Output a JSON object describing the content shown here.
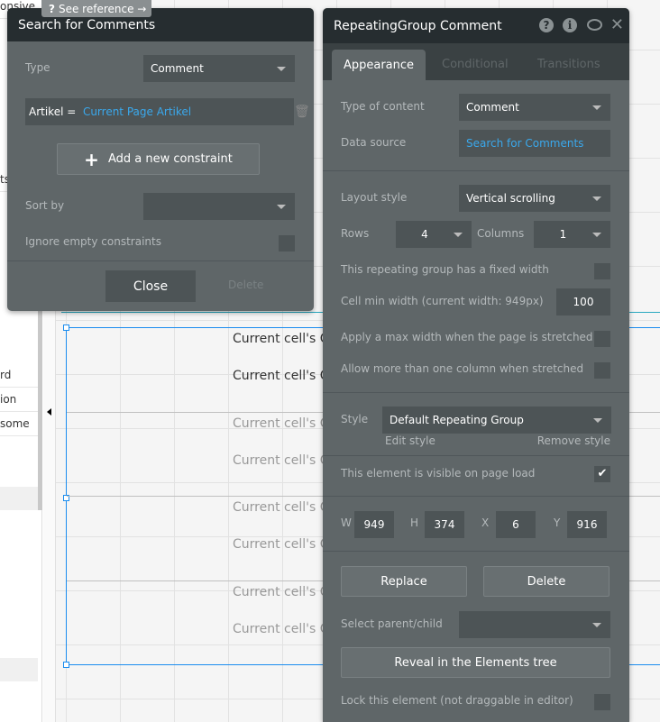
{
  "sidebar_fragments": [
    "onsive",
    "ts",
    "rd",
    "ion",
    "some"
  ],
  "canvas": {
    "cell_text": "Current cell's C",
    "rows": 8
  },
  "see_reference": "See reference →",
  "search_panel": {
    "title": "Search for Comments",
    "type_label": "Type",
    "type_value": "Comment",
    "constraint_field": "Artikel =",
    "constraint_value": "Current Page Artikel",
    "add_constraint": "Add a new constraint",
    "sort_label": "Sort by",
    "sort_value": "",
    "ignore_label": "Ignore empty constraints",
    "ignore_checked": false,
    "close": "Close",
    "delete": "Delete"
  },
  "rg_panel": {
    "title": "RepeatingGroup Comment",
    "tabs": [
      {
        "label": "Appearance",
        "active": true
      },
      {
        "label": "Conditional",
        "active": false
      },
      {
        "label": "Transitions",
        "active": false
      }
    ],
    "type_label": "Type of content",
    "type_value": "Comment",
    "source_label": "Data source",
    "source_value": "Search for Comments",
    "layout_label": "Layout style",
    "layout_value": "Vertical scrolling",
    "rows_label": "Rows",
    "rows_value": "4",
    "cols_label": "Columns",
    "cols_value": "1",
    "fixed_width_label": "This repeating group has a fixed width",
    "fixed_width": false,
    "cell_min_label": "Cell min width (current width: 949px)",
    "cell_min_value": "100",
    "max_width_label": "Apply a max width when the page is stretched",
    "max_width": false,
    "multi_col_label": "Allow more than one column when stretched",
    "multi_col": false,
    "style_label": "Style",
    "style_value": "Default Repeating Group",
    "edit_style": "Edit style",
    "remove_style": "Remove style",
    "visible_label": "This element is visible on page load",
    "visible": true,
    "w_label": "W",
    "w": "949",
    "h_label": "H",
    "h": "374",
    "x_label": "X",
    "x": "6",
    "y_label": "Y",
    "y": "916",
    "replace": "Replace",
    "delete": "Delete",
    "parent_label": "Select parent/child",
    "parent_value": "",
    "reveal": "Reveal in the Elements tree",
    "lock_label": "Lock this element (not draggable in editor)",
    "lock": false
  },
  "colors": {
    "accent": "#1a8cef",
    "link": "#3aa8ec",
    "panel": "#5f6668",
    "header": "#262d30"
  }
}
